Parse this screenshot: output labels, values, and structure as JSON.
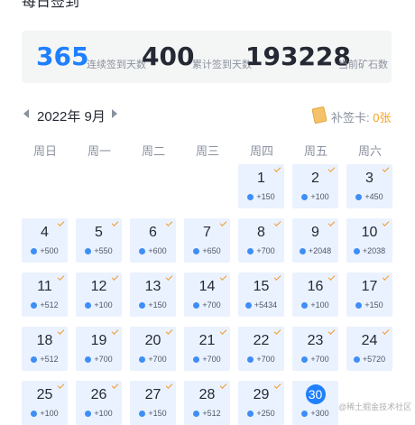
{
  "page": {
    "title": "每日签到"
  },
  "stats": [
    {
      "value": "365",
      "label": "连续签到天数",
      "color": "#1e80ff"
    },
    {
      "value": "400",
      "label": "累计签到天数",
      "color": "#252933"
    },
    {
      "value": "193228",
      "label": "当前矿石数",
      "color": "#252933"
    }
  ],
  "calendar": {
    "month_label": "2022年 9月",
    "retro_card_label": "补签卡:",
    "retro_card_count": "0张",
    "weekdays": [
      "周日",
      "周一",
      "周二",
      "周三",
      "周四",
      "周五",
      "周六"
    ],
    "first_weekday_index": 4,
    "today": "30",
    "days": [
      {
        "day": "1",
        "gain": "+150"
      },
      {
        "day": "2",
        "gain": "+100"
      },
      {
        "day": "3",
        "gain": "+450"
      },
      {
        "day": "4",
        "gain": "+500"
      },
      {
        "day": "5",
        "gain": "+550"
      },
      {
        "day": "6",
        "gain": "+600"
      },
      {
        "day": "7",
        "gain": "+650"
      },
      {
        "day": "8",
        "gain": "+700"
      },
      {
        "day": "9",
        "gain": "+2048"
      },
      {
        "day": "10",
        "gain": "+2038"
      },
      {
        "day": "11",
        "gain": "+512"
      },
      {
        "day": "12",
        "gain": "+100"
      },
      {
        "day": "13",
        "gain": "+150"
      },
      {
        "day": "14",
        "gain": "+700"
      },
      {
        "day": "15",
        "gain": "+5434"
      },
      {
        "day": "16",
        "gain": "+100"
      },
      {
        "day": "17",
        "gain": "+150"
      },
      {
        "day": "18",
        "gain": "+512"
      },
      {
        "day": "19",
        "gain": "+700"
      },
      {
        "day": "20",
        "gain": "+700"
      },
      {
        "day": "21",
        "gain": "+700"
      },
      {
        "day": "22",
        "gain": "+700"
      },
      {
        "day": "23",
        "gain": "+700"
      },
      {
        "day": "24",
        "gain": "+5720"
      },
      {
        "day": "25",
        "gain": "+100"
      },
      {
        "day": "26",
        "gain": "+100"
      },
      {
        "day": "27",
        "gain": "+150"
      },
      {
        "day": "28",
        "gain": "+512"
      },
      {
        "day": "29",
        "gain": "+250"
      },
      {
        "day": "30",
        "gain": "+300"
      }
    ]
  },
  "watermark": "@稀土掘金技术社区",
  "colors": {
    "accent": "#1e80ff",
    "check": "#f39a2c",
    "day_bg": "#eaf2ff"
  }
}
